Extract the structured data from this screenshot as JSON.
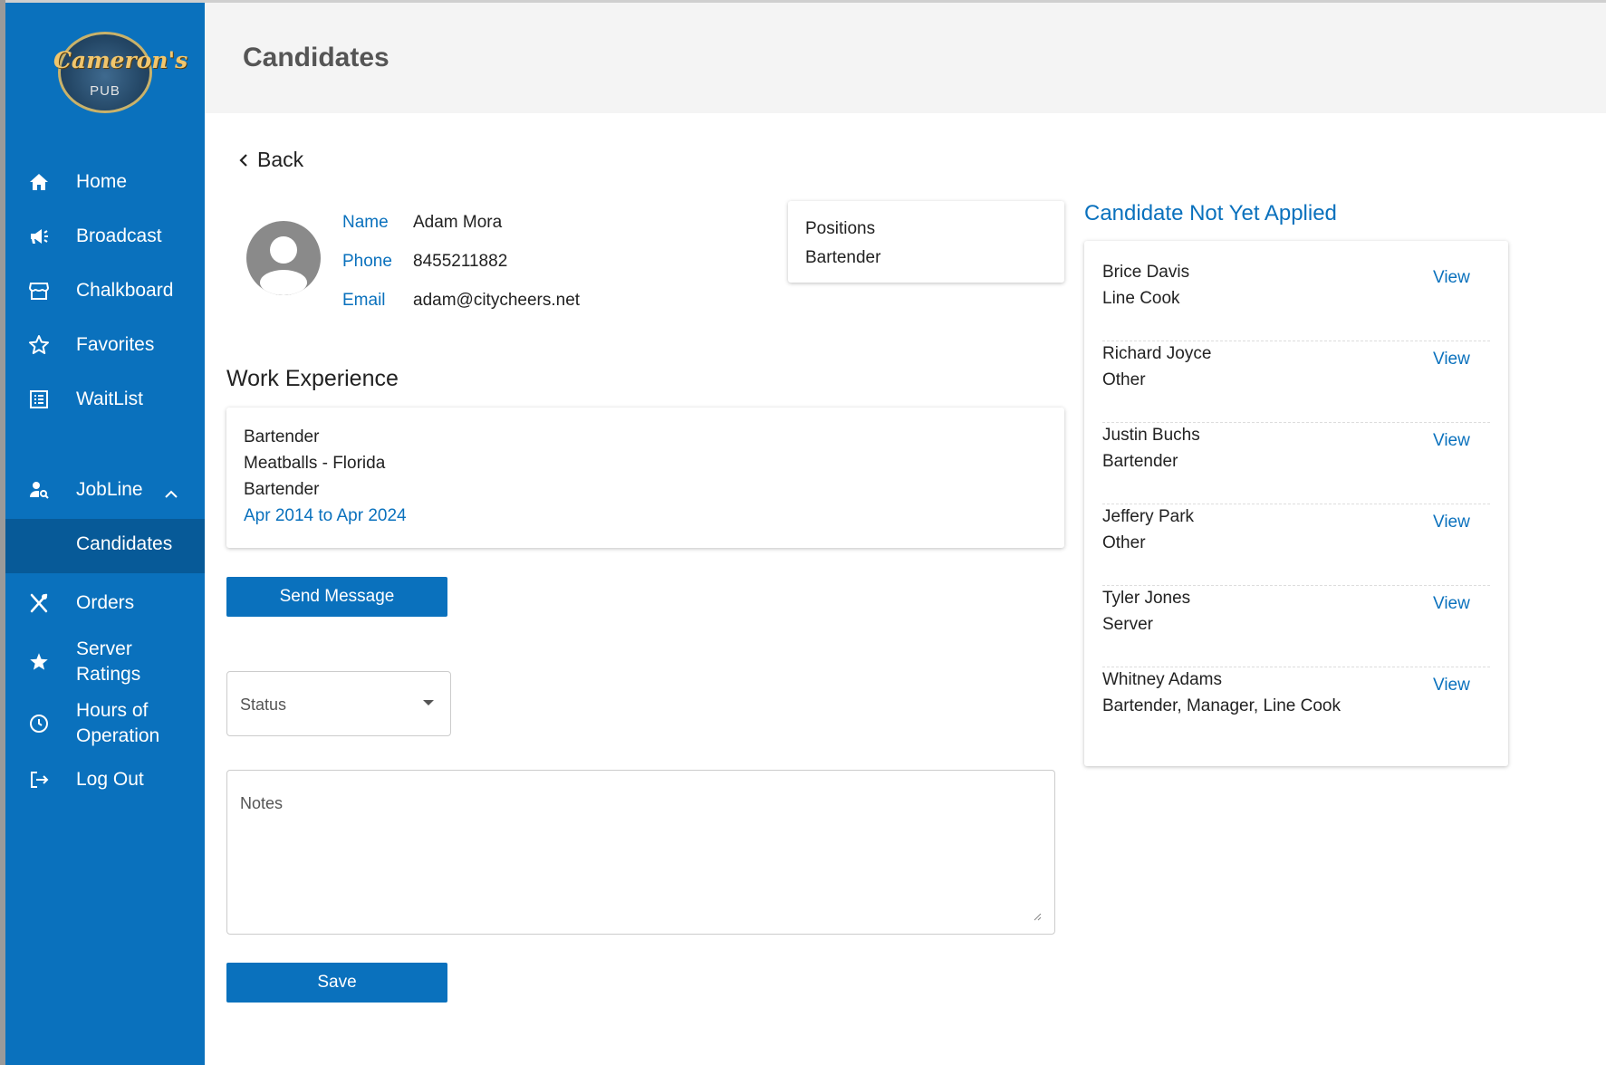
{
  "brand": {
    "name": "Cameron's",
    "sub": "PUB"
  },
  "nav": {
    "home": "Home",
    "broadcast": "Broadcast",
    "chalkboard": "Chalkboard",
    "favorites": "Favorites",
    "waitlist": "WaitList",
    "jobline": "JobLine",
    "candidates": "Candidates",
    "orders": "Orders",
    "server_ratings_1": "Server",
    "server_ratings_2": "Ratings",
    "hours_1": "Hours of",
    "hours_2": "Operation",
    "logout": "Log Out"
  },
  "header": {
    "title": "Candidates"
  },
  "back_label": "Back",
  "candidate": {
    "name_label": "Name",
    "name": "Adam Mora",
    "phone_label": "Phone",
    "phone": "8455211882",
    "email_label": "Email",
    "email": "adam@citycheers.net"
  },
  "positions": {
    "label": "Positions",
    "value": "Bartender"
  },
  "work_experience": {
    "title": "Work Experience",
    "items": [
      {
        "title": "Bartender",
        "company": "Meatballs - Florida",
        "role": "Bartender",
        "dates": "Apr 2014 to Apr 2024"
      }
    ]
  },
  "send_message_label": "Send Message",
  "status": {
    "placeholder": "Status"
  },
  "notes": {
    "placeholder": "Notes"
  },
  "save_label": "Save",
  "not_applied": {
    "title": "Candidate Not Yet Applied",
    "view_label": "View",
    "items": [
      {
        "name": "Brice Davis",
        "position": "Line Cook"
      },
      {
        "name": "Richard Joyce",
        "position": "Other"
      },
      {
        "name": "Justin Buchs",
        "position": "Bartender"
      },
      {
        "name": "Jeffery Park",
        "position": "Other"
      },
      {
        "name": "Tyler Jones",
        "position": "Server"
      },
      {
        "name": "Whitney Adams",
        "position": "Bartender, Manager, Line Cook"
      }
    ]
  },
  "colors": {
    "primary": "#0a71bd",
    "sidebar_active": "#075a98",
    "header_bg": "#f4f4f4"
  }
}
